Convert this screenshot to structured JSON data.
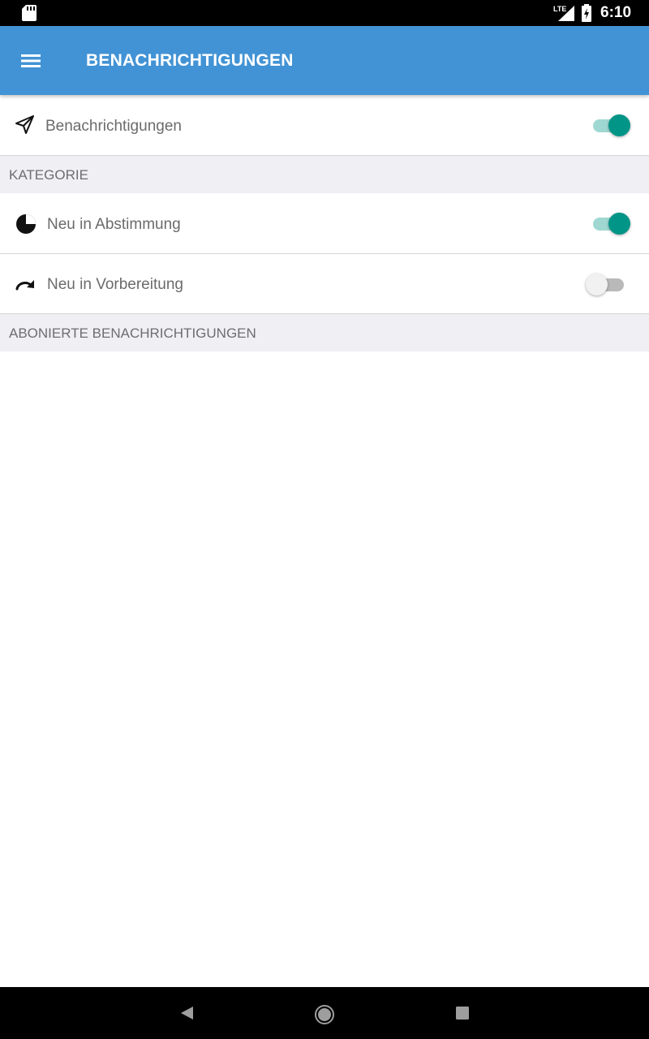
{
  "status_bar": {
    "time": "6:10",
    "network": "LTE",
    "icons": [
      "sd-card-icon",
      "signal-icon",
      "battery-charging-icon"
    ]
  },
  "app_bar": {
    "title": "BENACHRICHTIGUNGEN",
    "menu_icon": "hamburger-menu-icon"
  },
  "notifications_row": {
    "label": "Benachrichtigungen",
    "icon": "paper-plane-icon",
    "enabled": true
  },
  "sections": {
    "category": "KATEGORIE",
    "subscribed": "ABONIERTE BENACHRICHTIGUNGEN"
  },
  "category_items": [
    {
      "label": "Neu in Abstimmung",
      "icon": "pie-chart-icon",
      "enabled": true
    },
    {
      "label": "Neu in Vorbereitung",
      "icon": "redo-arrow-icon",
      "enabled": false
    }
  ],
  "nav_bar": {
    "icons": [
      "back-icon",
      "home-icon",
      "recents-icon"
    ]
  },
  "colors": {
    "app_bar": "#4293d5",
    "toggle_on": "#009587",
    "section_bg": "#efeff4"
  }
}
